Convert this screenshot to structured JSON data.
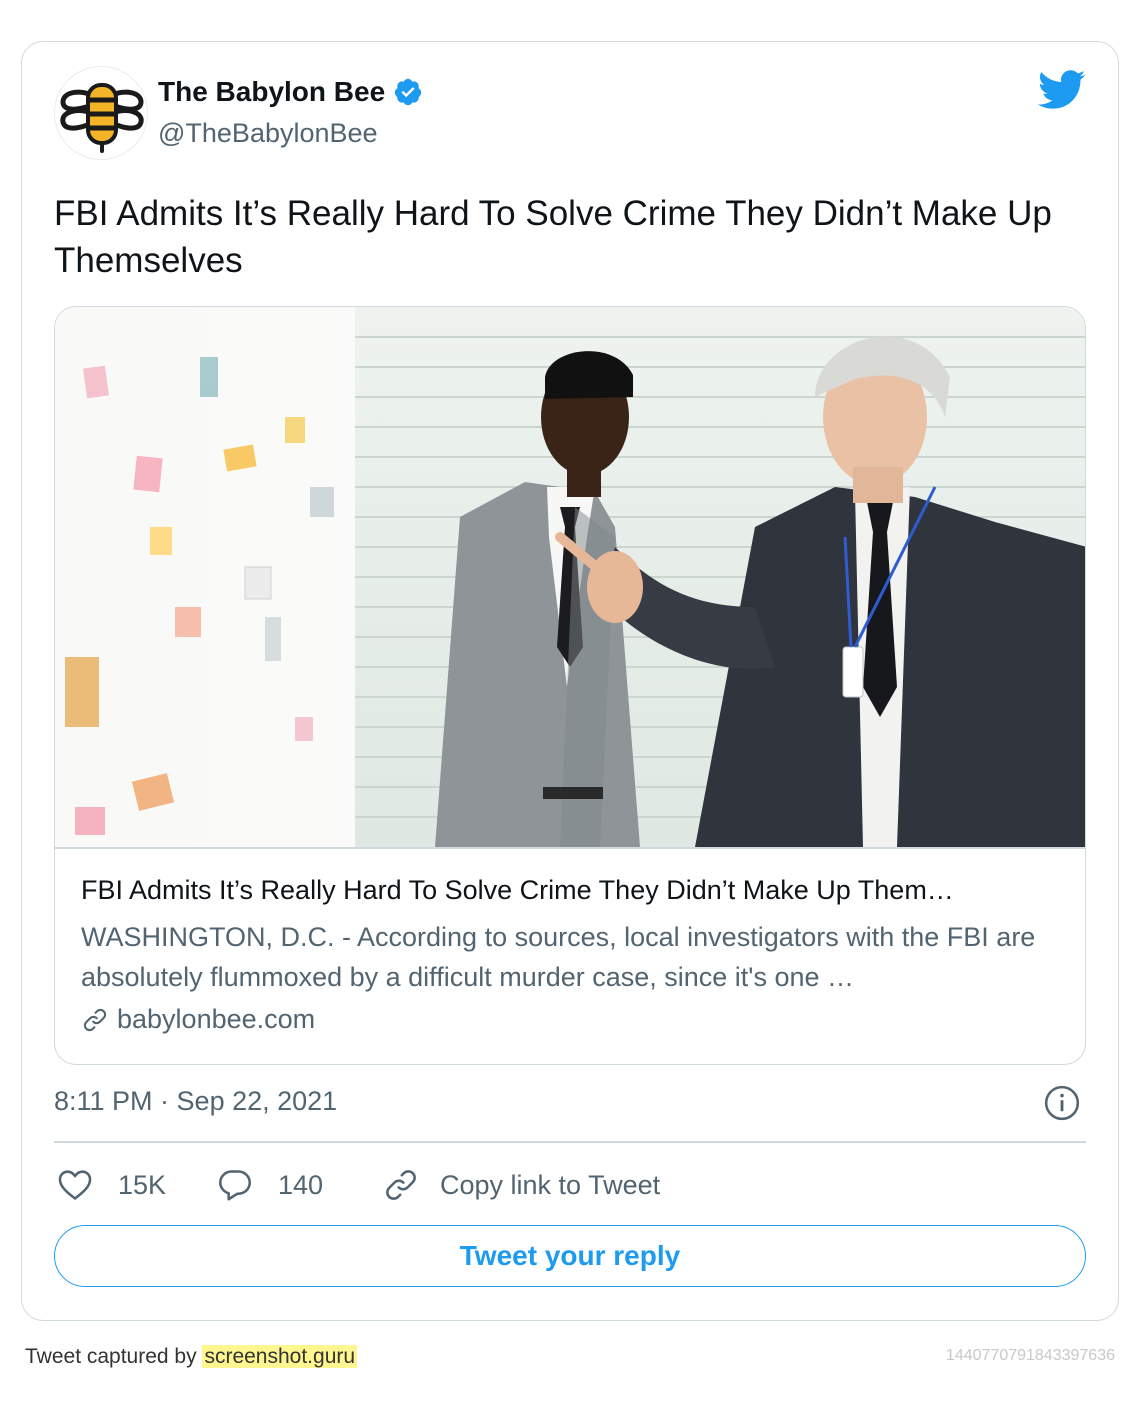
{
  "author": {
    "name": "The Babylon Bee",
    "handle": "@TheBabylonBee",
    "verified": true
  },
  "tweet": {
    "text": "FBI Admits It’s Really Hard To Solve Crime They Didn’t Make Up Themselves",
    "timestamp": "8:11 PM · Sep 22, 2021"
  },
  "link_card": {
    "title": "FBI Admits It’s Really Hard To Solve Crime They Didn’t Make Up Them…",
    "description": "WASHINGTON, D.C. - According to sources, local investigators with the FBI are absolutely flummoxed by a difficult murder case, since it's one …",
    "domain": "babylonbee.com"
  },
  "actions": {
    "likes": "15K",
    "replies": "140",
    "copy_link": "Copy link to Tweet"
  },
  "reply_button": "Tweet your reply",
  "footer": {
    "captured_by": "Tweet captured by",
    "brand": "screenshot.guru",
    "tweet_id": "1440770791843397636"
  },
  "colors": {
    "accent": "#1d9bf0",
    "text": "#0f1419",
    "muted": "#536471",
    "border": "#cfd9de",
    "highlight": "#fff68f"
  },
  "icons": {
    "logo": "babylon-bee-logo",
    "verified": "verified-badge-icon",
    "brand": "twitter-bird-icon",
    "link": "link-icon",
    "info": "info-icon",
    "like": "heart-icon",
    "reply": "reply-bubble-icon",
    "copy": "link-icon"
  }
}
